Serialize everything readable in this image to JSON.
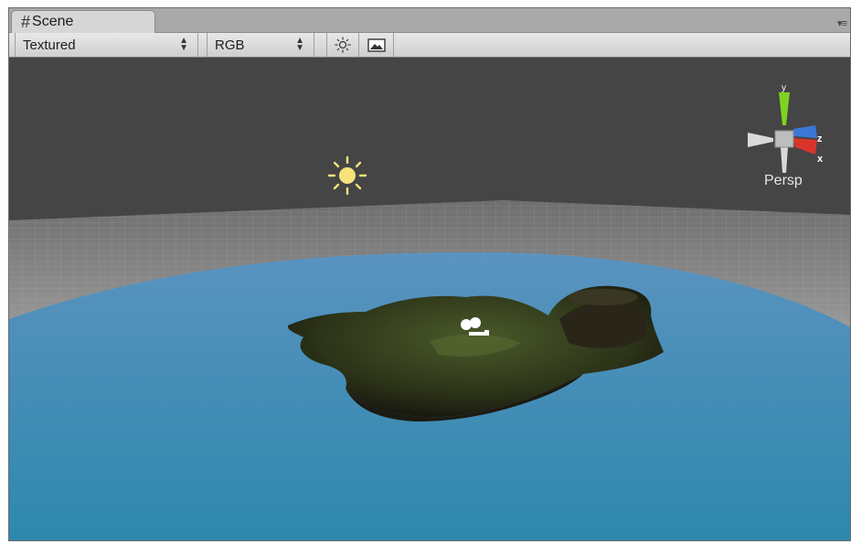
{
  "tab": {
    "label": "Scene",
    "icon": "hash-icon"
  },
  "toolbar": {
    "render_mode": {
      "value": "Textured",
      "icon": "up-down-arrows-icon"
    },
    "color_mode": {
      "value": "RGB",
      "icon": "up-down-arrows-icon"
    },
    "scene_lighting_icon": "sun-icon",
    "game_overlay_icon": "image-icon"
  },
  "gizmo": {
    "label": "Persp",
    "axes": [
      "y",
      "z",
      "x"
    ],
    "colors": {
      "y": "#7ed321",
      "z": "#3a78d8",
      "x": "#d9342b"
    }
  },
  "colors": {
    "sky": "#454545",
    "grid": "#8a8a8a",
    "water_top": "#5a93c0",
    "water_bottom": "#2d88ac",
    "light_icon": "#f7e27a"
  }
}
